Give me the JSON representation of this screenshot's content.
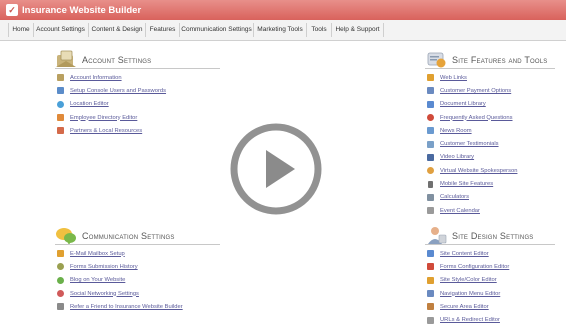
{
  "app": {
    "title": "Insurance Website Builder"
  },
  "nav": [
    "Home",
    "Account Settings",
    "Content & Design",
    "Features",
    "Communication Settings",
    "Marketing Tools",
    "Tools",
    "Help & Support"
  ],
  "sections": {
    "account": {
      "title": "Account Settings",
      "items": [
        {
          "label": "Account Information",
          "icon": "folder-icon",
          "color": "#b9a060"
        },
        {
          "label": "Setup Console Users and Passwords",
          "icon": "users-icon",
          "color": "#5b8cc9"
        },
        {
          "label": "Location Editor",
          "icon": "globe-icon",
          "color": "#4aa0d8"
        },
        {
          "label": "Employee Directory Editor",
          "icon": "person-icon",
          "color": "#e08a3a"
        },
        {
          "label": "Partners & Local Resources",
          "icon": "handshake-icon",
          "color": "#d46a4a"
        }
      ]
    },
    "features": {
      "title": "Site Features and Tools",
      "items": [
        {
          "label": "Web Links",
          "icon": "link-icon",
          "color": "#e0a030"
        },
        {
          "label": "Customer Payment Options",
          "icon": "card-icon",
          "color": "#6a8ac0"
        },
        {
          "label": "Document Library",
          "icon": "document-icon",
          "color": "#5a8ad0"
        },
        {
          "label": "Frequently Asked Questions",
          "icon": "help-icon",
          "color": "#d04a3a"
        },
        {
          "label": "News Room",
          "icon": "news-icon",
          "color": "#6a9ad0"
        },
        {
          "label": "Customer Testimonials",
          "icon": "chat-icon",
          "color": "#7aa0c8"
        },
        {
          "label": "Video Library",
          "icon": "video-icon",
          "color": "#4a6aa0"
        },
        {
          "label": "Virtual Website Spokesperson",
          "icon": "spokesperson-icon",
          "color": "#e0a040"
        },
        {
          "label": "Mobile Site Features",
          "icon": "mobile-icon",
          "color": "#707070"
        },
        {
          "label": "Calculators",
          "icon": "calculator-icon",
          "color": "#8090a0"
        },
        {
          "label": "Event Calendar",
          "icon": "calendar-icon",
          "color": "#9a9a9a"
        }
      ]
    },
    "communication": {
      "title": "Communication Settings",
      "items": [
        {
          "label": "E-Mail Mailbox Setup",
          "icon": "mailbox-icon",
          "color": "#e0a030"
        },
        {
          "label": "Forms Submission History",
          "icon": "history-icon",
          "color": "#9aa050"
        },
        {
          "label": "Blog on Your Website",
          "icon": "blog-icon",
          "color": "#6ab04a"
        },
        {
          "label": "Social Networking Settings",
          "icon": "social-icon",
          "color": "#d05a5a"
        },
        {
          "label": "Refer a Friend to Insurance Website Builder",
          "icon": "refer-icon",
          "color": "#8a8a8a"
        }
      ]
    },
    "design": {
      "title": "Site Design Settings",
      "items": [
        {
          "label": "Site Content Editor",
          "icon": "content-icon",
          "color": "#5a8ad0"
        },
        {
          "label": "Forms Configuration Editor",
          "icon": "forms-icon",
          "color": "#d04a3a"
        },
        {
          "label": "Site Style/Color Editor",
          "icon": "palette-icon",
          "color": "#e0a030"
        },
        {
          "label": "Navigation Menu Editor",
          "icon": "menu-icon",
          "color": "#6a8ac0"
        },
        {
          "label": "Secure Area Editor",
          "icon": "lock-icon",
          "color": "#c08040"
        },
        {
          "label": "URLs & Redirect Editor",
          "icon": "url-icon",
          "color": "#9a9a9a"
        }
      ]
    }
  },
  "overlay": {
    "icon": "play-icon"
  }
}
